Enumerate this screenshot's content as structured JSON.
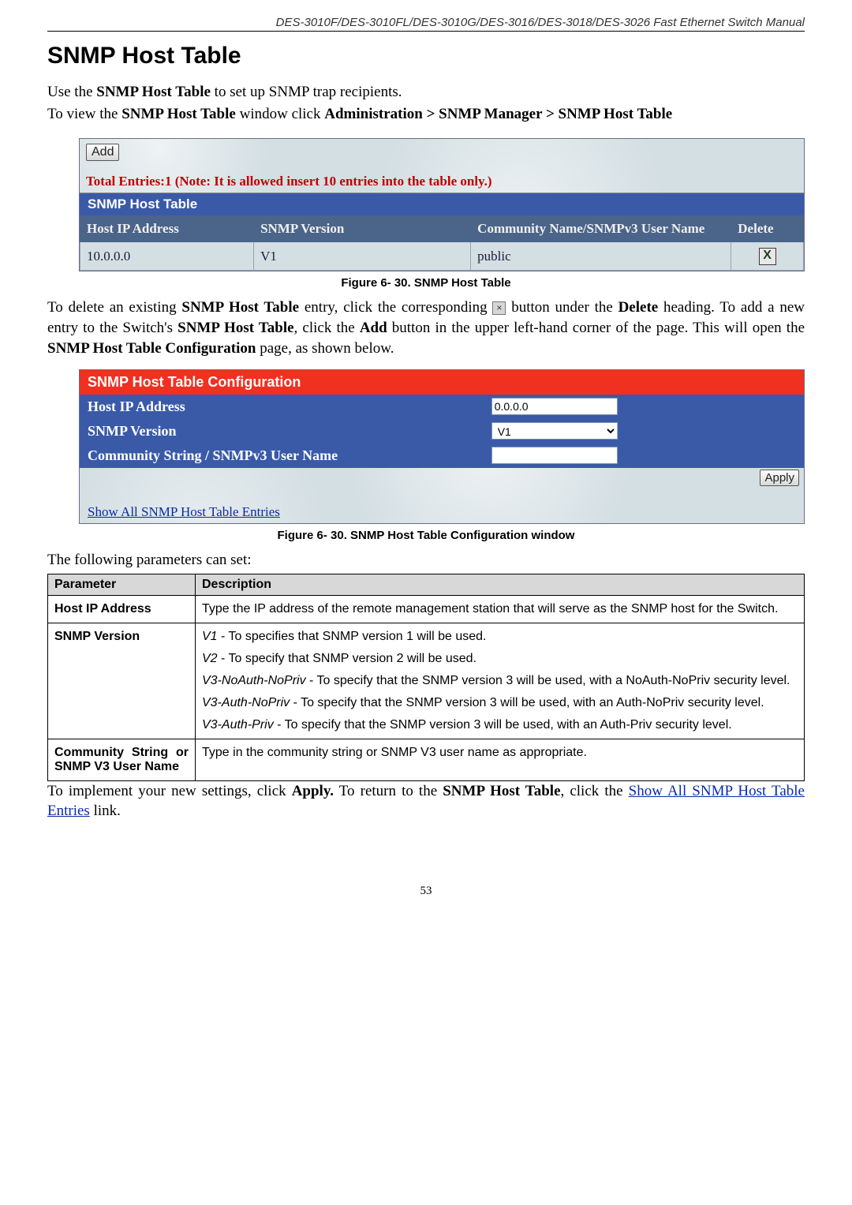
{
  "header": "DES-3010F/DES-3010FL/DES-3010G/DES-3016/DES-3018/DES-3026 Fast Ethernet Switch Manual",
  "title": "SNMP Host Table",
  "intro_1_a": "Use the ",
  "intro_1_b": "SNMP Host Table",
  "intro_1_c": " to set up SNMP trap recipients.",
  "intro_2_a": "To view the ",
  "intro_2_b": "SNMP Host Table",
  "intro_2_c": " window click ",
  "intro_2_d": "Administration > SNMP Manager > SNMP Host Table",
  "shot1": {
    "add": "Add",
    "total_note": "Total Entries:1 (Note: It is allowed insert 10 entries into the table only.)",
    "titlebar": "SNMP Host Table",
    "cols": {
      "c1": "Host IP Address",
      "c2": "SNMP Version",
      "c3": "Community Name/SNMPv3 User Name",
      "c4": "Delete"
    },
    "row": {
      "ip": "10.0.0.0",
      "ver": "V1",
      "comm": "public",
      "xbtn": "X"
    }
  },
  "fig1": "Figure 6- 30. SNMP Host Table",
  "para2_a": "To delete an existing ",
  "para2_b": "SNMP Host Table",
  "para2_c": " entry, click the corresponding ",
  "para2_d": " button under the ",
  "para2_e": "Delete",
  "para2_f": " heading. To add a new entry to the Switch's ",
  "para2_g": "SNMP Host Table",
  "para2_h": ", click the ",
  "para2_i": "Add",
  "para2_j": " button in the upper left-hand corner of the page.  This will open the ",
  "para2_k": "SNMP Host Table Configuration",
  "para2_l": " page, as shown below.",
  "shot2": {
    "title": "SNMP Host Table Configuration",
    "host_lab": "Host IP Address",
    "host_val": "0.0.0.0",
    "ver_lab": "SNMP Version",
    "ver_val": "V1",
    "comm_lab": "Community String / SNMPv3 User Name",
    "apply": "Apply",
    "showlink": "Show All SNMP Host Table Entries"
  },
  "fig2": "Figure 6- 30. SNMP Host Table Configuration window",
  "para3": "The following parameters can set:",
  "param_head_1": "Parameter",
  "param_head_2": "Description",
  "rows": {
    "r1_name": "Host IP Address",
    "r1_desc": "Type the IP address of the remote management station that will serve as the SNMP host for the Switch.",
    "r2_name": "SNMP Version",
    "r2_v1_a": "V1",
    "r2_v1_b": " - To specifies that SNMP version 1 will be used.",
    "r2_v2_a": "V2",
    "r2_v2_b": " - To specify that SNMP version 2 will be used.",
    "r2_v3a_a": "V3-NoAuth-NoPriv",
    "r2_v3a_b": " - To specify that the SNMP version 3 will be used, with a NoAuth-NoPriv security level.",
    "r2_v3b_a": "V3-Auth-NoPriv",
    "r2_v3b_b": " - To specify that the SNMP version 3 will be used, with an Auth-NoPriv security level.",
    "r2_v3c_a": "V3-Auth-Priv",
    "r2_v3c_b": " - To specify that the SNMP version 3 will be used, with an Auth-Priv security level.",
    "r3_name": "Community String or SNMP V3 User Name",
    "r3_desc": "Type in the community string or SNMP V3 user name as appropriate."
  },
  "footer_a": "To implement your new settings, click ",
  "footer_b": "Apply.",
  "footer_c": " To return to the ",
  "footer_d": "SNMP Host Table",
  "footer_e": ", click the ",
  "footer_f": "Show All SNMP Host Table Entries",
  "footer_g": " link.",
  "page_num": "53",
  "inline_x": "×"
}
